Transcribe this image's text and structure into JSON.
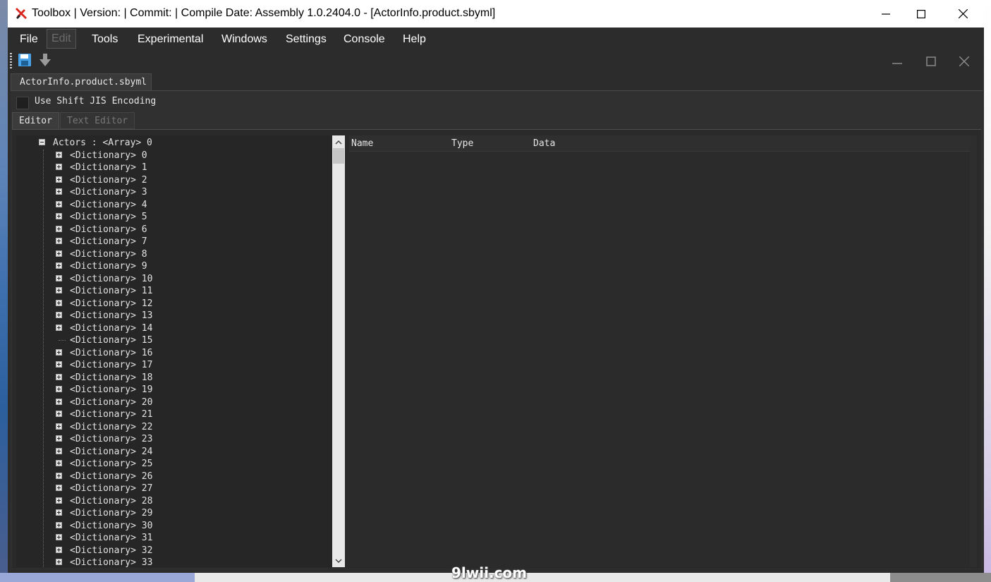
{
  "window": {
    "title": "Toolbox | Version:  | Commit:  | Compile Date:  Assembly 1.0.2404.0 - [ActorInfo.product.sbyml]"
  },
  "menu": [
    {
      "label": "File",
      "enabled": true
    },
    {
      "label": "Edit",
      "enabled": false
    },
    {
      "label": "Tools",
      "enabled": true
    },
    {
      "label": "Experimental",
      "enabled": true
    },
    {
      "label": "Windows",
      "enabled": true
    },
    {
      "label": "Settings",
      "enabled": true
    },
    {
      "label": "Console",
      "enabled": true
    },
    {
      "label": "Help",
      "enabled": true
    }
  ],
  "document_tab": "ActorInfo.product.sbyml",
  "shift_jis": {
    "label": "Use Shift JIS Encoding",
    "checked": false
  },
  "editor_tabs": [
    {
      "label": "Editor",
      "active": true
    },
    {
      "label": "Text Editor",
      "active": false
    }
  ],
  "tree": {
    "root": "Actors : <Array> 0",
    "children": [
      "<Dictionary> 0",
      "<Dictionary> 1",
      "<Dictionary> 2",
      "<Dictionary> 3",
      "<Dictionary> 4",
      "<Dictionary> 5",
      "<Dictionary> 6",
      "<Dictionary> 7",
      "<Dictionary> 8",
      "<Dictionary> 9",
      "<Dictionary> 10",
      "<Dictionary> 11",
      "<Dictionary> 12",
      "<Dictionary> 13",
      "<Dictionary> 14",
      "<Dictionary> 15",
      "<Dictionary> 16",
      "<Dictionary> 17",
      "<Dictionary> 18",
      "<Dictionary> 19",
      "<Dictionary> 20",
      "<Dictionary> 21",
      "<Dictionary> 22",
      "<Dictionary> 23",
      "<Dictionary> 24",
      "<Dictionary> 25",
      "<Dictionary> 26",
      "<Dictionary> 27",
      "<Dictionary> 28",
      "<Dictionary> 29",
      "<Dictionary> 30",
      "<Dictionary> 31",
      "<Dictionary> 32",
      "<Dictionary> 33"
    ],
    "leaf_index": 15
  },
  "grid_columns": [
    "Name",
    "Type",
    "Data"
  ],
  "watermark": "9lwii.com",
  "colors": {
    "save_icon": "#4aa3e8",
    "menu_bg": "#2c2c2c"
  }
}
